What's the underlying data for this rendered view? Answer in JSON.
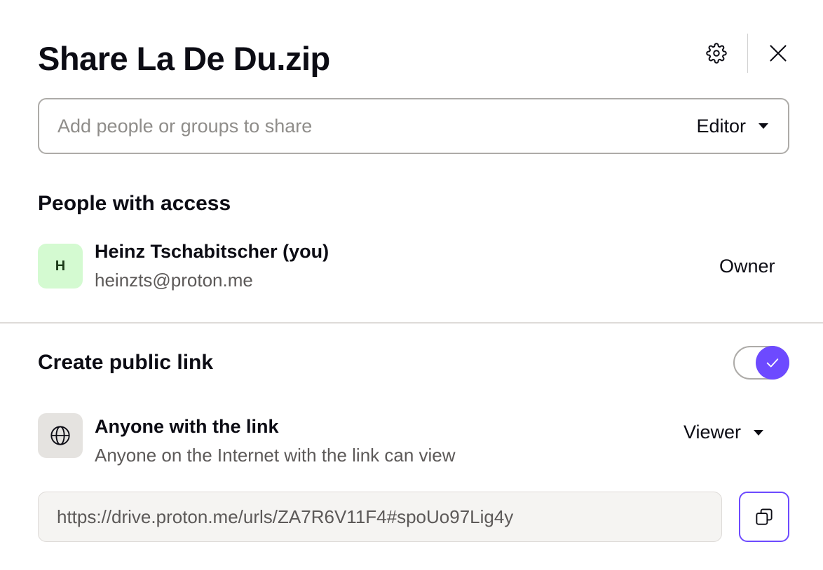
{
  "dialog": {
    "title": "Share La De Du.zip",
    "settings_icon": "gear-icon",
    "close_icon": "close-icon"
  },
  "add_people": {
    "placeholder": "Add people or groups to share",
    "value": "",
    "role": "Editor"
  },
  "people_section": {
    "title": "People with access",
    "members": [
      {
        "initial": "H",
        "name": "Heinz Tschabitscher (you)",
        "email": "heinzts@proton.me",
        "role": "Owner",
        "avatar_color": "#d4fad1"
      }
    ]
  },
  "public_link": {
    "title": "Create public link",
    "enabled": true,
    "access_icon": "globe-icon",
    "access_title": "Anyone with the link",
    "access_description": "Anyone on the Internet with the link can view",
    "permission": "Viewer",
    "url": "https://drive.proton.me/urls/ZA7R6V11F4#spoUo97Lig4y",
    "copy_icon": "copy-icon"
  },
  "colors": {
    "accent": "#6d4aff",
    "text": "#0c0c14",
    "muted_text": "#5c5958"
  }
}
